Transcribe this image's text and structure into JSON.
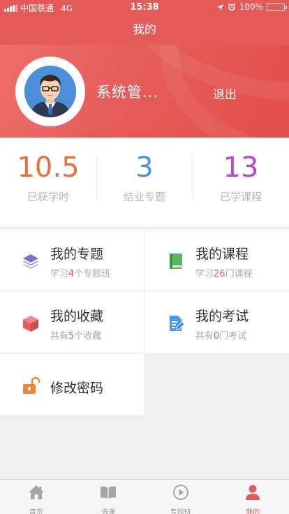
{
  "status_bar": {
    "carrier": "中国联通",
    "network": "4G",
    "time": "15:38",
    "battery": "100%",
    "battery_level": 1.0
  },
  "nav": {
    "title": "我的"
  },
  "profile": {
    "name": "系统管...",
    "logout_label": "退出"
  },
  "stats": [
    {
      "value": "10.5",
      "label": "已获学时",
      "color": "#e8703c"
    },
    {
      "value": "3",
      "label": "结业专题",
      "color": "#4a90e2"
    },
    {
      "value": "13",
      "label": "已学课程",
      "color": "#b44ac8"
    }
  ],
  "menu": {
    "topics": {
      "title": "我的专题",
      "sub_pre": "学习",
      "sub_num": "4",
      "sub_post": "个专题班"
    },
    "courses": {
      "title": "我的课程",
      "sub_pre": "学习",
      "sub_num": "26",
      "sub_post": "门课程"
    },
    "favorites": {
      "title": "我的收藏",
      "sub_pre": "共有",
      "sub_num": "5",
      "sub_post": "个收藏"
    },
    "exams": {
      "title": "我的考试",
      "sub_pre": "共有",
      "sub_num": "0",
      "sub_post": "门考试"
    },
    "password": {
      "title": "修改密码"
    }
  },
  "tabs": [
    {
      "label": "首页",
      "icon": "home-icon"
    },
    {
      "label": "选课",
      "icon": "book-icon"
    },
    {
      "label": "专题班",
      "icon": "play-circle-icon"
    },
    {
      "label": "我的",
      "icon": "user-icon"
    }
  ],
  "colors": {
    "brand": "#e35a58",
    "icon_topics": "#7b6fd6",
    "icon_courses": "#5ab55e",
    "icon_favorites": "#e85f5f",
    "icon_exams": "#4a9be5",
    "icon_password": "#ea8a3a"
  }
}
